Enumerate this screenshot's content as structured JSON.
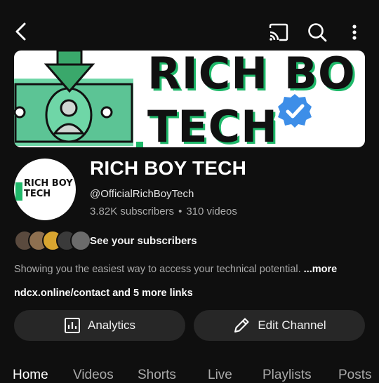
{
  "topbar": {
    "back_icon": "back-arrow-icon",
    "cast_icon": "cast-icon",
    "search_icon": "search-icon",
    "more_icon": "more-vert-icon"
  },
  "banner": {
    "line1": "RICH BO",
    "line2": "TECH",
    "accent_color": "#1fb96a"
  },
  "avatar": {
    "line1": "RICH BOY",
    "line2": "TECH"
  },
  "channel": {
    "name": "RICH BOY TECH",
    "handle": "@OfficialRichBoyTech",
    "subscribers": "3.82K subscribers",
    "separator": "•",
    "videos": "310 videos"
  },
  "subscribers_row": {
    "label": "See your subscribers"
  },
  "description": {
    "text": "Showing you the easiest way to access your technical potential.",
    "more": "...more"
  },
  "links": {
    "main": "ndcx.online/contact",
    "rest": " and 5 more links"
  },
  "buttons": {
    "analytics": "Analytics",
    "edit_channel": "Edit Channel"
  },
  "tabs": [
    "Home",
    "Videos",
    "Shorts",
    "Live",
    "Playlists",
    "Posts"
  ]
}
